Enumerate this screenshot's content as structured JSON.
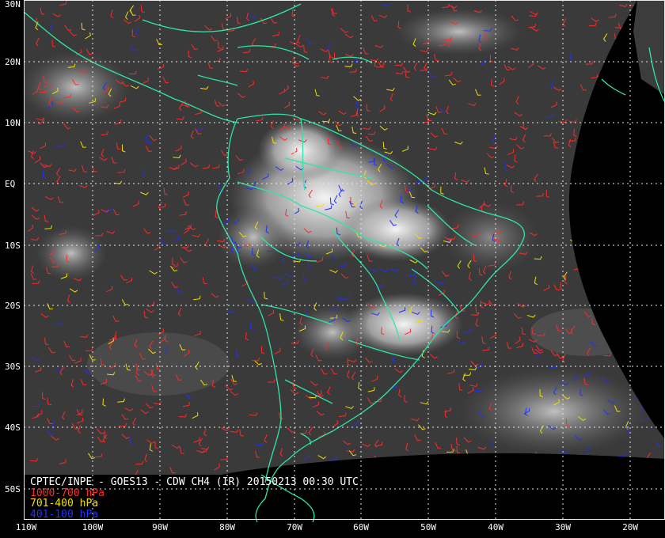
{
  "title": "CPTEC/INPE - GOES13 - CDW CH4 (IR) 20150213 00:30 UTC",
  "legend": [
    {
      "label": "1000-700 hPa",
      "color": "#ff2a2a"
    },
    {
      "label": "701-400 hPa",
      "color": "#f0e000"
    },
    {
      "label": "401-100 hPa",
      "color": "#2030ff"
    }
  ],
  "coastline_color": "#2ee6a6",
  "grid_color": "#e8e8e8",
  "lat_labels": [
    "30N",
    "20N",
    "10N",
    "EQ",
    "10S",
    "20S",
    "30S",
    "40S",
    "50S"
  ],
  "lon_labels": [
    "110W",
    "100W",
    "90W",
    "80W",
    "70W",
    "60W",
    "50W",
    "40W",
    "30W",
    "20W"
  ]
}
